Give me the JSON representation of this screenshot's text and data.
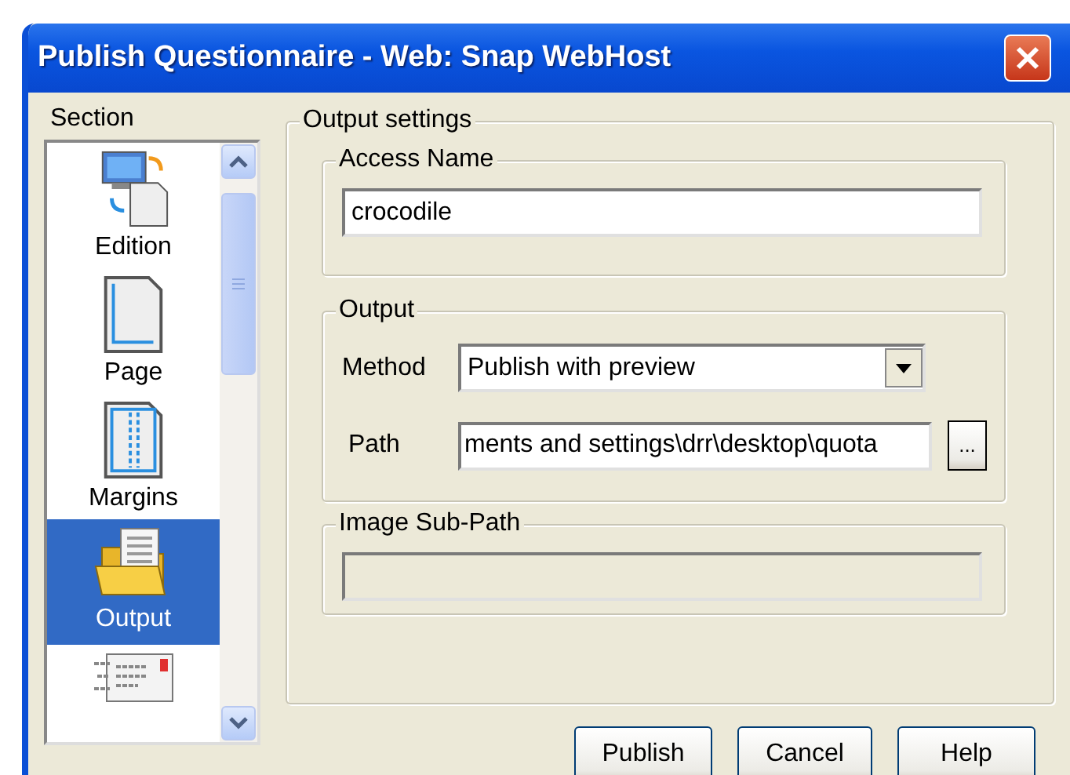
{
  "window": {
    "title": "Publish Questionnaire - Web: Snap WebHost"
  },
  "section": {
    "label": "Section",
    "items": [
      {
        "label": "Edition",
        "kind": "edition",
        "selected": false
      },
      {
        "label": "Page",
        "kind": "page",
        "selected": false
      },
      {
        "label": "Margins",
        "kind": "margins",
        "selected": false
      },
      {
        "label": "Output",
        "kind": "output",
        "selected": true
      },
      {
        "kind": "email",
        "selected": false
      }
    ]
  },
  "output_settings": {
    "title": "Output settings",
    "access_name": {
      "title": "Access Name",
      "value": "crocodile"
    },
    "output": {
      "title": "Output",
      "method_label": "Method",
      "method_value": "Publish with preview",
      "path_label": "Path",
      "path_value": "ments and settings\\drr\\desktop\\quota",
      "browse": "..."
    },
    "image_sub_path": {
      "title": "Image Sub-Path",
      "disabled": true
    }
  },
  "buttons": [
    "Publish",
    "Cancel",
    "Help"
  ]
}
